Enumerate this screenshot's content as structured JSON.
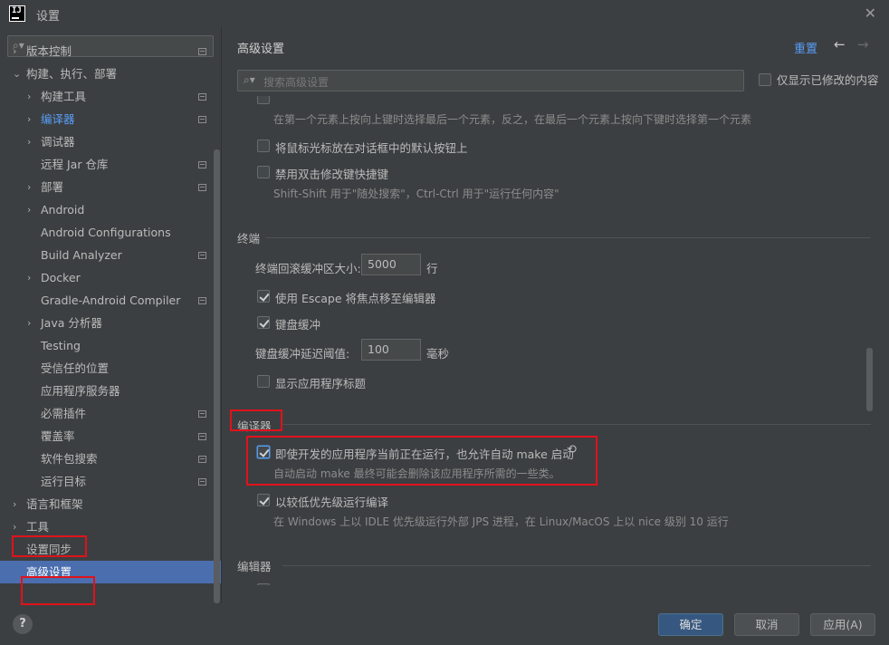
{
  "window": {
    "title": "设置",
    "logo": "IJ"
  },
  "sidebar": {
    "search_placeholder": "",
    "items": [
      {
        "label": "版本控制",
        "arrow": "›",
        "badge": true
      },
      {
        "label": "构建、执行、部署",
        "arrow": "⌄",
        "badge": false
      },
      {
        "label": "构建工具",
        "arrow": "›",
        "badge": true
      },
      {
        "label": "编译器",
        "arrow": "›",
        "badge": true
      },
      {
        "label": "调试器",
        "arrow": "›",
        "badge": false
      },
      {
        "label": "远程 Jar 仓库",
        "arrow": "",
        "badge": true
      },
      {
        "label": "部署",
        "arrow": "›",
        "badge": true
      },
      {
        "label": "Android",
        "arrow": "›",
        "badge": false
      },
      {
        "label": "Android Configurations",
        "arrow": "",
        "badge": false
      },
      {
        "label": "Build Analyzer",
        "arrow": "",
        "badge": true
      },
      {
        "label": "Docker",
        "arrow": "›",
        "badge": false
      },
      {
        "label": "Gradle-Android Compiler",
        "arrow": "",
        "badge": true
      },
      {
        "label": "Java 分析器",
        "arrow": "›",
        "badge": false
      },
      {
        "label": "Testing",
        "arrow": "",
        "badge": false
      },
      {
        "label": "受信任的位置",
        "arrow": "",
        "badge": false
      },
      {
        "label": "应用程序服务器",
        "arrow": "",
        "badge": false
      },
      {
        "label": "必需插件",
        "arrow": "",
        "badge": true
      },
      {
        "label": "覆盖率",
        "arrow": "",
        "badge": true
      },
      {
        "label": "软件包搜索",
        "arrow": "",
        "badge": true
      },
      {
        "label": "运行目标",
        "arrow": "",
        "badge": true
      },
      {
        "label": "语言和框架",
        "arrow": "›",
        "badge": false
      },
      {
        "label": "工具",
        "arrow": "›",
        "badge": false
      },
      {
        "label": "设置同步",
        "arrow": "",
        "badge": false
      },
      {
        "label": "高级设置",
        "arrow": "",
        "badge": false
      }
    ]
  },
  "main": {
    "title": "高级设置",
    "reset_label": "重置",
    "back_icon": "←",
    "forward_icon": "→",
    "search_placeholder": "搜索高级设置",
    "only_modified_label": "仅显示已修改的内容",
    "top_desc": "在第一个元素上按向上键时选择最后一个元素，反之，在最后一个元素上按向下键时选择第一个元素",
    "opt_mouse_default": "将鼠标光标放在对话框中的默认按钮上",
    "opt_disable_double": "禁用双击修改键快捷键",
    "opt_disable_double_desc": "Shift-Shift 用于\"随处搜索\"，Ctrl-Ctrl 用于\"运行任何内容\"",
    "terminal": {
      "section": "终端",
      "buffer_label": "终端回滚缓冲区大小:",
      "buffer_value": "5000",
      "buffer_unit": "行",
      "escape_label": "使用 Escape 将焦点移至编辑器",
      "kbd_buffer_label": "键盘缓冲",
      "kbd_delay_label": "键盘缓冲延迟阈值:",
      "kbd_delay_value": "100",
      "kbd_delay_unit": "毫秒",
      "show_title_label": "显示应用程序标题"
    },
    "compiler": {
      "section": "编译器",
      "auto_make_label": "即使开发的应用程序当前正在运行，也允许自动 make 启动",
      "auto_make_desc": "自动启动 make 最终可能会删除该应用程序所需的一些类。",
      "low_priority_label": "以较低优先级运行编译",
      "low_priority_desc": "在 Windows 上以 IDLE 优先级运行外部 JPS 进程，在 Linux/MacOS 上以 nice 级别 10 运行"
    },
    "editor": {
      "section": "编辑器"
    }
  },
  "footer": {
    "help": "?",
    "ok_label": "确定",
    "cancel_label": "取消",
    "apply_label": "应用(A)"
  }
}
